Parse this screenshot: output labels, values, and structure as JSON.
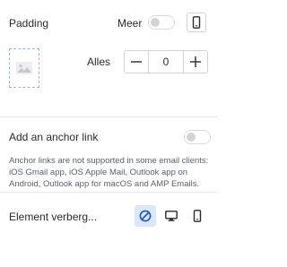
{
  "padding": {
    "label": "Padding",
    "meer_label": "Meer",
    "meer_toggle_on": false,
    "alles_label": "Alles",
    "value": "0",
    "minus": "—",
    "plus": "+"
  },
  "anchor": {
    "label": "Add an anchor link",
    "toggle_on": false,
    "note": "Anchor links are not supported in some email clients: iOS Gmail app, iOS Apple Mail, Outlook app on Android, Outlook app for macOS and AMP Emails."
  },
  "visibility": {
    "label": "Element verberg...",
    "buttons": [
      {
        "icon": "hide-none-icon",
        "active": true
      },
      {
        "icon": "desktop-icon",
        "active": false
      },
      {
        "icon": "mobile-icon",
        "active": false
      }
    ]
  },
  "colors": {
    "accent": "#1a56c4",
    "active_bg": "#dbe8fb",
    "divider": "#e4e6ea"
  }
}
